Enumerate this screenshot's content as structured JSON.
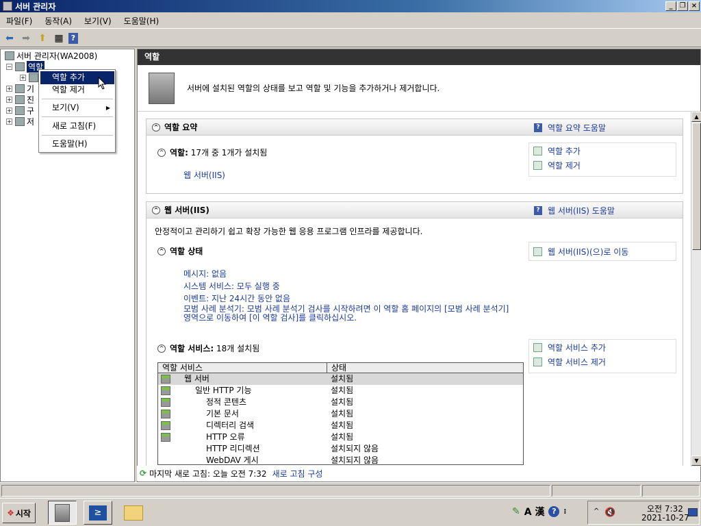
{
  "window": {
    "title": "서버 관리자"
  },
  "menu": [
    "파일(F)",
    "동작(A)",
    "보기(V)",
    "도움말(H)"
  ],
  "tree": {
    "root": "서버 관리자(WA2008)",
    "selected": "역할",
    "items": [
      "기",
      "진",
      "구",
      "저"
    ]
  },
  "context_menu": {
    "add_role": "역할 추가",
    "remove_role": "역할 제거",
    "view": "보기(V)",
    "refresh": "새로 고침(F)",
    "help": "도움말(H)"
  },
  "main": {
    "header": "역할",
    "intro": "서버에 설치된 역할의 상태를 보고 역할 및 기능을 추가하거나 제거합니다.",
    "summary": {
      "title": "역할 요약",
      "help": "역할 요약 도움말",
      "roles_label": "역할:",
      "roles_value": "17개 중 1개가 설치됨",
      "installed_role": "웹 서버(IIS)",
      "add_roles": "역할 추가",
      "remove_roles": "역할 제거"
    },
    "iis": {
      "title": "웹 서버(IIS)",
      "help": "웹 서버(IIS) 도움말",
      "desc": "안정적이고 관리하기 쉽고 확장 가능한 웹 응용 프로그램 인프라를 제공합니다.",
      "status_title": "역할 상태",
      "goto": "웹 서버(IIS)(으)로 이동",
      "messages": "메시지: 없음",
      "system_services": "시스템 서비스: 모두 실행 중",
      "events": "이벤트: 지난 24시간 동안 없음",
      "bpa": "모범 사례 분석기: 모범 사례 분석기 검사를 시작하려면 이 역할 홈 페이지의 [모범 사례 분석기] 영역으로 이동하여 [이 역할 검사]를 클릭하십시오.",
      "services_title": "역할 서비스:",
      "services_count": "18개 설치됨",
      "add_services": "역할 서비스 추가",
      "remove_services": "역할 서비스 제거",
      "table": {
        "col1": "역할 서비스",
        "col2": "상태",
        "rows": [
          {
            "name": "웹 서버",
            "status": "설치됨"
          },
          {
            "name": "일반 HTTP 기능",
            "status": "설치됨"
          },
          {
            "name": "정적 콘텐츠",
            "status": "설치됨"
          },
          {
            "name": "기본 문서",
            "status": "설치됨"
          },
          {
            "name": "디렉터리 검색",
            "status": "설치됨"
          },
          {
            "name": "HTTP 오류",
            "status": "설치됨"
          },
          {
            "name": "HTTP 리디렉션",
            "status": "설치되지 않음"
          },
          {
            "name": "WebDAV 게시",
            "status": "설치되지 않음"
          }
        ]
      }
    },
    "status_bar": {
      "last_refresh": "마지막 새로 고침: 오늘 오전 7:32",
      "configure": "새로 고침 구성"
    }
  },
  "taskbar": {
    "start": "시작",
    "ime": "A 漢",
    "time": "오전 7:32",
    "date": "2021-10-27"
  }
}
